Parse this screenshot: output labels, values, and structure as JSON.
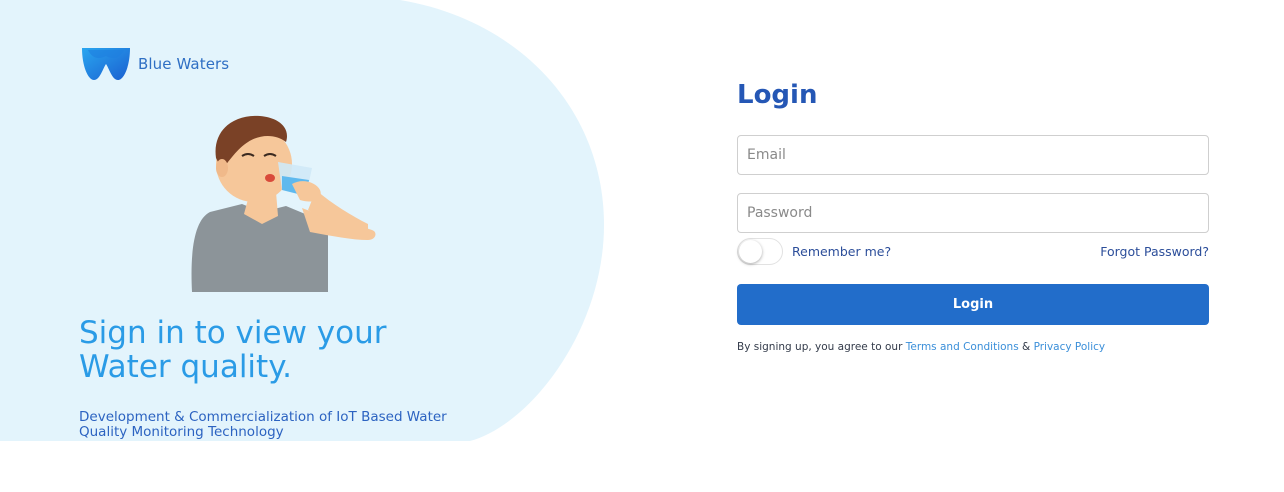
{
  "brand": {
    "name": "Blue Waters",
    "logo_icon": "blue-waters-logo-icon"
  },
  "hero": {
    "illustration": "man-drinking-water-illustration",
    "headline": "Sign in to view your Water quality.",
    "subline": "Development & Commercialization of IoT Based Water Quality Monitoring Technology"
  },
  "login": {
    "title": "Login",
    "email_placeholder": "Email",
    "password_placeholder": "Password",
    "remember_label": "Remember me?",
    "remember_checked": false,
    "forgot_label": "Forgot Password?",
    "submit_label": "Login",
    "terms_prefix": "By signing up, you agree to our",
    "terms_link": "Terms and Conditions",
    "terms_and": "&",
    "privacy_link": "Privacy Policy"
  },
  "colors": {
    "panel_bg": "#e3f4fc",
    "accent": "#226dca",
    "headline": "#2a9be6",
    "title": "#2557b5"
  }
}
